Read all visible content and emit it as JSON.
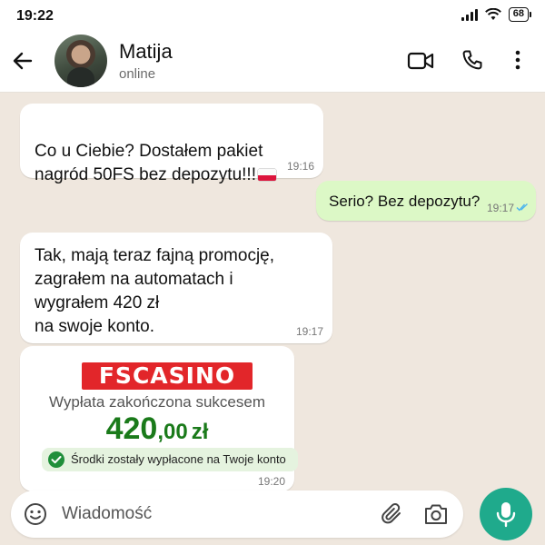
{
  "status_bar": {
    "time": "19:22",
    "battery": "68"
  },
  "header": {
    "name": "Matija",
    "status": "online"
  },
  "messages": [
    {
      "direction": "in",
      "text": "Co u Ciebie? Dostałem pakiet\nnagród 50FS bez depozytu!!!",
      "time": "19:16"
    },
    {
      "direction": "out",
      "text": "Serio? Bez depozytu?",
      "time": "19:17"
    },
    {
      "direction": "in",
      "text": "Tak, mają teraz fajną promocję,\nzagrałem na automatach i\nwygrałem 420 zł\nna swoje konto.",
      "time": "19:17"
    }
  ],
  "casino_card": {
    "logo": "FSCASINO",
    "title": "Wypłata zakończona sukcesem",
    "amount_main": "420",
    "amount_cents": ",00",
    "currency": "zł",
    "success_text": "Środki zostały wypłacone na Twoje konto",
    "time": "19:20"
  },
  "input": {
    "placeholder": "Wiadomość"
  },
  "colors": {
    "incoming": "#ffffff",
    "outgoing": "#dcf8c6",
    "background": "#efe7de",
    "accent": "#1faa8c",
    "amount": "#1a7a1a",
    "logo": "#e2262a"
  },
  "icons": [
    "back-arrow-icon",
    "video-call-icon",
    "phone-icon",
    "more-menu-icon",
    "emoji-icon",
    "paperclip-icon",
    "camera-icon",
    "microphone-icon",
    "double-check-icon",
    "check-circle-icon",
    "poland-flag-icon"
  ]
}
